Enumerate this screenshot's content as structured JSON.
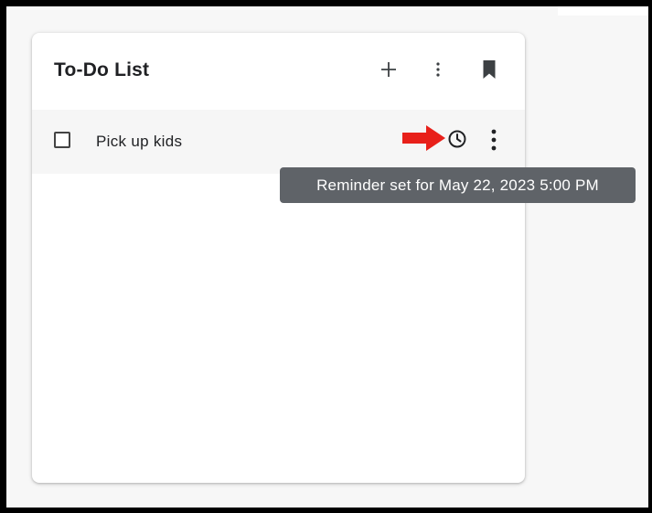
{
  "card": {
    "title": "To-Do List",
    "actions": [
      {
        "name": "add-icon"
      },
      {
        "name": "more-vert-icon"
      },
      {
        "name": "bookmark-icon"
      }
    ]
  },
  "tasks": [
    {
      "label": "Pick up kids",
      "checked": false,
      "reminder_icon": "clock-icon",
      "menu_icon": "more-vert-icon"
    }
  ],
  "tooltip": {
    "text": "Reminder set for May 22, 2023 5:00 PM"
  },
  "annotation": {
    "arrow_color": "#e8201a",
    "points_to": "clock-icon"
  },
  "colors": {
    "tooltip_bg": "#5f6368",
    "row_bg": "#f6f6f6",
    "page_bg": "#f7f7f7"
  }
}
